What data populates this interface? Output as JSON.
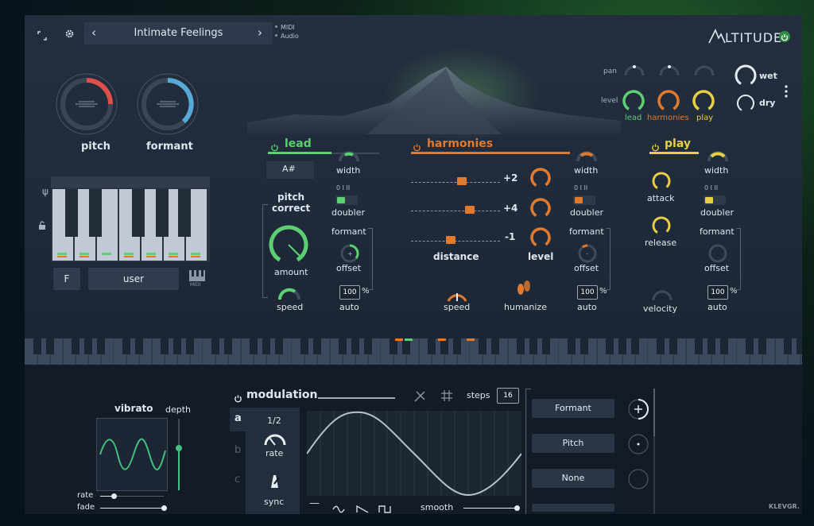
{
  "header": {
    "preset_name": "Intimate Feelings",
    "io_modes": [
      "MIDI",
      "Audio"
    ],
    "logo": "LTITUDE"
  },
  "colors": {
    "lead": "#5ccf72",
    "harmonies": "#e07a2f",
    "play": "#e6cf44",
    "pitch": "#e0504a",
    "formant": "#57a9d6"
  },
  "tuning": {
    "pitch_label": "pitch",
    "formant_label": "formant"
  },
  "scale": {
    "key": "F",
    "mode": "user",
    "midi_label": "MIDI"
  },
  "mix": {
    "pan_label": "pan",
    "level_label": "level",
    "wet_label": "wet",
    "dry_label": "dry",
    "voices": [
      "lead",
      "harmonies",
      "play"
    ]
  },
  "lead": {
    "title": "lead",
    "note": "A#",
    "pitch_correct": "pitch\ncorrect",
    "pitch_correct_1": "pitch",
    "pitch_correct_2": "correct",
    "amount": "amount",
    "speed": "speed",
    "width": "width",
    "doubler": "doubler",
    "doubler_marks": "0 I II",
    "formant": "formant",
    "offset": "offset",
    "auto": "auto",
    "auto_value": "100",
    "pct": "%"
  },
  "harmonies": {
    "title": "harmonies",
    "intervals": [
      "+2",
      "+4",
      "-1"
    ],
    "distance": "distance",
    "level": "level",
    "speed": "speed",
    "humanize": "humanize",
    "width": "width",
    "doubler": "doubler",
    "doubler_marks": "0 I II",
    "formant": "formant",
    "offset": "offset",
    "auto": "auto",
    "auto_value": "100",
    "pct": "%"
  },
  "play": {
    "title": "play",
    "attack": "attack",
    "release": "release",
    "velocity": "velocity",
    "width": "width",
    "doubler": "doubler",
    "doubler_marks": "0 I II",
    "formant": "formant",
    "offset": "offset",
    "auto": "auto",
    "auto_value": "100",
    "pct": "%"
  },
  "vibrato": {
    "title": "vibrato",
    "depth": "depth",
    "rate": "rate",
    "fade": "fade"
  },
  "modulation": {
    "title": "modulation",
    "steps_label": "steps",
    "steps_value": "16",
    "slots": [
      "a",
      "b",
      "c"
    ],
    "rate_value": "1/2",
    "rate": "rate",
    "sync": "sync",
    "smooth": "smooth",
    "targets": [
      "Formant",
      "Pitch",
      "None"
    ]
  },
  "footer": {
    "brand": "KLEVGR."
  }
}
